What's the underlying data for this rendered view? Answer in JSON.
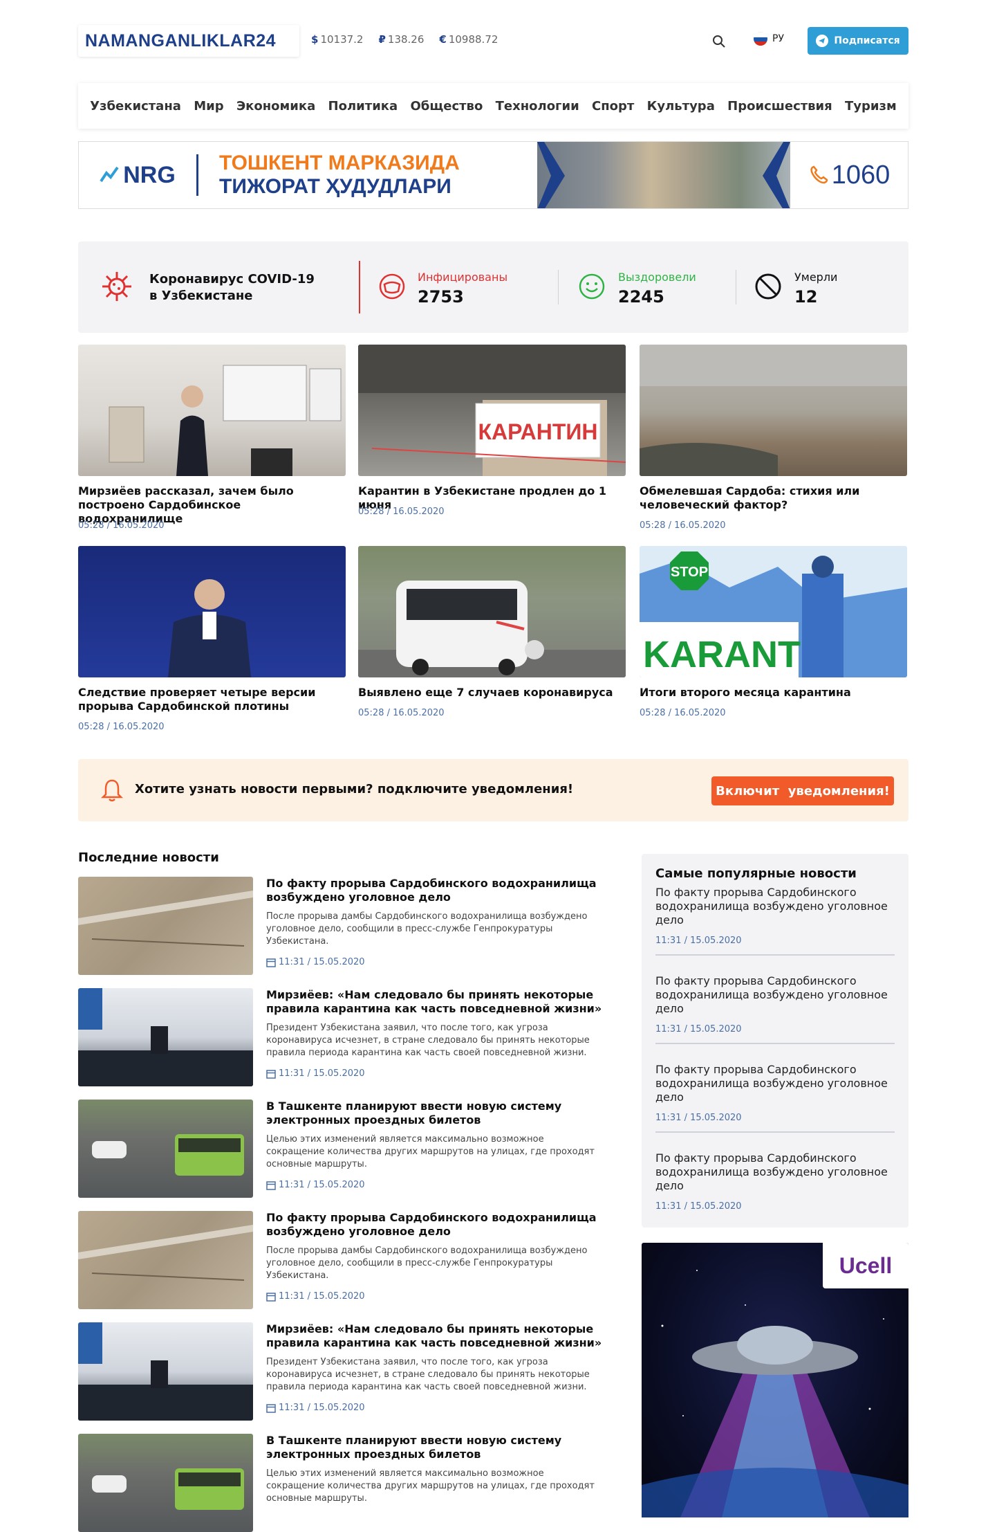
{
  "header": {
    "logo": "NAMANGANLIKLAR24",
    "rates": [
      {
        "symbol": "$",
        "value": "10137.2"
      },
      {
        "symbol": "₽",
        "value": "138.26"
      },
      {
        "symbol": "€",
        "value": "10988.72"
      }
    ],
    "lang": "РУ",
    "subscribe": "Подписатся"
  },
  "nav": [
    "Узбекистана",
    "Мир",
    "Экономика",
    "Политика",
    "Общество",
    "Технологии",
    "Спорт",
    "Культура",
    "Происшествия",
    "Туризм"
  ],
  "banner": {
    "brand": "NRG",
    "line1": "ТОШКЕНТ МАРКАЗИДА",
    "line2": "ТИЖОРАТ ҲУДУДЛАРИ",
    "phone": "1060"
  },
  "covid": {
    "title_line1": "Коронавирус COVID-19",
    "title_line2": "в Узбекистане",
    "infected_label": "Инфицированы",
    "infected": "2753",
    "recovered_label": "Выздоровели",
    "recovered": "2245",
    "died_label": "Умерли",
    "died": "12"
  },
  "cards": [
    {
      "title": "Мирзиёев рассказал, зачем было построено Сардобинское водохранилище",
      "date": "05:28 / 16.05.2020",
      "img_label": ""
    },
    {
      "title": "Карантин в Узбекистане продлен до 1 июня",
      "date": "05:28 / 16.05.2020",
      "img_label": "КАРАНТИН"
    },
    {
      "title": "Обмелевшая Сардоба: стихия или человеческий фактор?",
      "date": "05:28 / 16.05.2020",
      "img_label": ""
    },
    {
      "title": "Следствие проверяет четыре версии прорыва Сардобинской плотины",
      "date": "05:28 / 16.05.2020",
      "img_label": ""
    },
    {
      "title": "Выявлено еще 7 случаев коронавируса",
      "date": "05:28 / 16.05.2020",
      "img_label": ""
    },
    {
      "title": "Итоги второго месяца карантина",
      "date": "05:28 / 16.05.2020",
      "img_label": "KARANTIN",
      "img_label2": "STOP"
    }
  ],
  "notify": {
    "text": "Хотите узнать новости первыми? подключите уведомления!",
    "button": "Включит  уведомления!"
  },
  "latest": {
    "title": "Последние новости",
    "items": [
      {
        "title": "По факту прорыва Сардобинского водохранилища возбуждено уголовное дело",
        "desc": "После прорыва дамбы Сардобинского водохранилища возбуждено уголовное дело, сообщили в пресс-службе Генпрокуратуры Узбекистана.",
        "date": "11:31 / 15.05.2020"
      },
      {
        "title": "Мирзиёев: «Нам следовало бы принять некоторые правила карантина как часть повседневной жизни»",
        "desc": "Президент Узбекистана заявил, что после того, как угроза коронавируса исчезнет, в стране следовало бы принять некоторые правила периода карантина как часть своей повседневной жизни.",
        "date": "11:31 / 15.05.2020"
      },
      {
        "title": "В Ташкенте планируют ввести новую систему электронных проездных билетов",
        "desc": "Целью этих изменений является максимально возможное сокращение количества других маршрутов на улицах, где проходят основные маршруты.",
        "date": "11:31 / 15.05.2020"
      },
      {
        "title": "По факту прорыва Сардобинского водохранилища возбуждено уголовное дело",
        "desc": "После прорыва дамбы Сардобинского водохранилища возбуждено уголовное дело, сообщили в пресс-службе Генпрокуратуры Узбекистана.",
        "date": "11:31 / 15.05.2020"
      },
      {
        "title": "Мирзиёев: «Нам следовало бы принять некоторые правила карантина как часть повседневной жизни»",
        "desc": "Президент Узбекистана заявил, что после того, как угроза коронавируса исчезнет, в стране следовало бы принять некоторые правила периода карантина как часть своей повседневной жизни.",
        "date": "11:31 / 15.05.2020"
      },
      {
        "title": "В Ташкенте планируют ввести новую систему электронных проездных билетов",
        "desc": "Целью этих изменений является максимально возможное сокращение количества других маршрутов на улицах, где проходят основные маршруты.",
        "date": "11:31 / 15.05.2020"
      }
    ]
  },
  "popular": {
    "title": "Самые популярные новости",
    "items": [
      {
        "title": "По факту прорыва Сардобинского водохранилища возбуждено уголовное дело",
        "date": "11:31 / 15.05.2020"
      },
      {
        "title": "По факту прорыва Сардобинского водохранилища возбуждено уголовное дело",
        "date": "11:31 / 15.05.2020"
      },
      {
        "title": "По факту прорыва Сардобинского водохранилища возбуждено уголовное дело",
        "date": "11:31 / 15.05.2020"
      },
      {
        "title": "По факту прорыва Сардобинского водохранилища возбуждено уголовное дело",
        "date": "11:31 / 15.05.2020"
      }
    ]
  },
  "ad": {
    "brand": "Ucell"
  },
  "colors": {
    "brand": "#1e3f8a",
    "accent": "#2f9ed6",
    "infected": "#e03131",
    "recovered": "#2fb344",
    "notify_btn": "#f15b2a"
  }
}
